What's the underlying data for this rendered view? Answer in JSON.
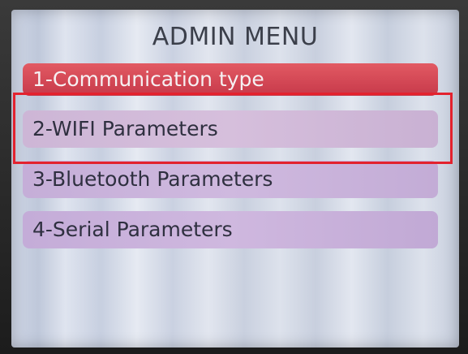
{
  "screen": {
    "title": "ADMIN MENU"
  },
  "menu": {
    "items": [
      {
        "label": "1-Communication type",
        "state": "selected"
      },
      {
        "label": "2-WIFI Parameters",
        "state": "highlighted-annotation"
      },
      {
        "label": "3-Bluetooth Parameters",
        "state": "normal"
      },
      {
        "label": "4-Serial Parameters",
        "state": "normal"
      }
    ]
  },
  "colors": {
    "selected_item": "#c7394a",
    "normal_item": "#cdb6d6",
    "annotation_box": "#e3222e",
    "title_text": "#3b3f4a"
  }
}
